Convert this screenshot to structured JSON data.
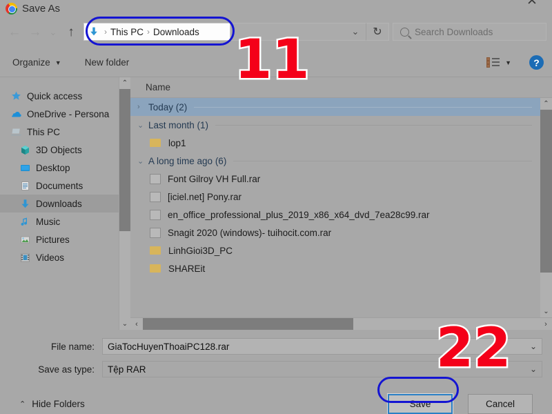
{
  "window": {
    "title": "Save As",
    "app_icon": "chrome-icon",
    "close_label": "✕"
  },
  "navbar": {
    "back_icon": "←",
    "forward_icon": "→",
    "recent_icon": "⌄",
    "up_icon": "↑",
    "breadcrumb": {
      "root_icon": "downloads-arrow-icon",
      "separator": "›",
      "items": [
        "This PC",
        "Downloads"
      ]
    },
    "address_dropdown_icon": "⌄",
    "refresh_icon": "↻",
    "search_placeholder": "Search Downloads"
  },
  "commandbar": {
    "organize_label": "Organize",
    "organize_caret": "▼",
    "new_folder_label": "New folder",
    "view_caret": "▼",
    "help_label": "?"
  },
  "sidebar": {
    "scroll_up_icon": "⌃",
    "scroll_down_icon": "⌄",
    "items": [
      {
        "label": "Quick access",
        "icon": "star-icon",
        "indent": 0,
        "selected": false
      },
      {
        "label": "OneDrive - Persona",
        "icon": "cloud-icon",
        "indent": 0,
        "selected": false
      },
      {
        "label": "This PC",
        "icon": "pc-icon",
        "indent": 0,
        "selected": false
      },
      {
        "label": "3D Objects",
        "icon": "cube-icon",
        "indent": 1,
        "selected": false
      },
      {
        "label": "Desktop",
        "icon": "desktop-icon",
        "indent": 1,
        "selected": false
      },
      {
        "label": "Documents",
        "icon": "documents-icon",
        "indent": 1,
        "selected": false
      },
      {
        "label": "Downloads",
        "icon": "downloads-icon",
        "indent": 1,
        "selected": true
      },
      {
        "label": "Music",
        "icon": "music-icon",
        "indent": 1,
        "selected": false
      },
      {
        "label": "Pictures",
        "icon": "pictures-icon",
        "indent": 1,
        "selected": false
      },
      {
        "label": "Videos",
        "icon": "videos-icon",
        "indent": 1,
        "selected": false
      }
    ]
  },
  "filelist": {
    "column_header": "Name",
    "collapsed_caret": "›",
    "expanded_caret": "⌄",
    "rows": [
      {
        "kind": "group",
        "label": "Today (2)",
        "expanded": false,
        "selected": true
      },
      {
        "kind": "group",
        "label": "Last month (1)",
        "expanded": true,
        "selected": false
      },
      {
        "kind": "file",
        "label": "lop1",
        "icon": "folder-icon"
      },
      {
        "kind": "group",
        "label": "A long time ago (6)",
        "expanded": true,
        "selected": false
      },
      {
        "kind": "file",
        "label": "Font Gilroy VH Full.rar",
        "icon": "document-icon"
      },
      {
        "kind": "file",
        "label": "[iciel.net] Pony.rar",
        "icon": "document-icon"
      },
      {
        "kind": "file",
        "label": "en_office_professional_plus_2019_x86_x64_dvd_7ea28c99.rar",
        "icon": "document-icon"
      },
      {
        "kind": "file",
        "label": "Snagit 2020 (windows)- tuihocit.com.rar",
        "icon": "document-icon"
      },
      {
        "kind": "file",
        "label": "LinhGioi3D_PC",
        "icon": "folder-icon"
      },
      {
        "kind": "file",
        "label": "SHAREit",
        "icon": "folder-icon"
      }
    ],
    "scroll_up_icon": "⌃",
    "scroll_down_icon": "⌄",
    "scroll_left_icon": "‹",
    "scroll_right_icon": "›"
  },
  "form": {
    "filename_label": "File name:",
    "filename_value": "GiaTocHuyenThoaiPC128.rar",
    "savetype_label": "Save as type:",
    "savetype_value": "Tệp RAR",
    "dropdown_icon": "⌄"
  },
  "footer": {
    "hide_folders_label": "Hide Folders",
    "hide_folders_icon": "⌃",
    "save_label": "Save",
    "cancel_label": "Cancel"
  },
  "annotations": {
    "step1": "1",
    "step2": "2",
    "ring_color": "#1414d2",
    "number_color": "#f40019"
  }
}
